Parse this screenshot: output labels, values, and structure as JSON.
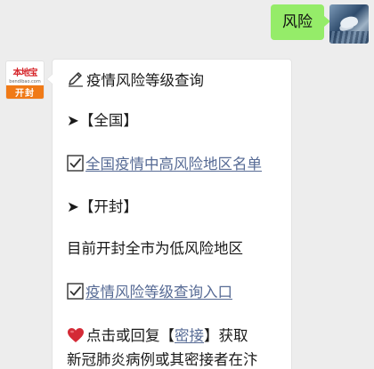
{
  "outgoing": {
    "text": "风险"
  },
  "incoming": {
    "avatar": {
      "logo_text": "本地宝",
      "site": "bendibao.com",
      "city": "开封"
    },
    "title": "疫情风险等级查询",
    "national_header": "➤【全国】",
    "national_link": "全国疫情中高风险地区名单",
    "city_header": "➤【开封】",
    "city_status": "目前开封全市为低风险地区",
    "city_link": "疫情风险等级查询入口",
    "promo_prefix": "点击或回复【",
    "promo_keyword": "密接",
    "promo_suffix": "】获取",
    "promo_line2": "新冠肺炎病例或其密接者在汴"
  },
  "icons": {
    "title_icon": "pencil-icon",
    "check_icon": "checkbox-icon",
    "heart_icon": "heart-icon"
  }
}
